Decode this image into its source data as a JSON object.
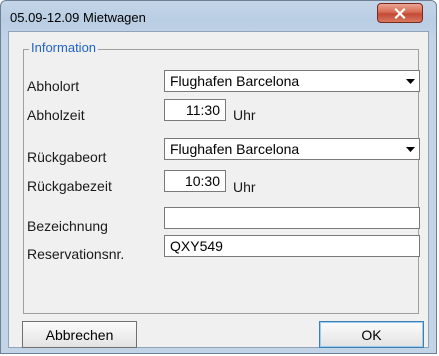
{
  "window": {
    "title": "05.09-12.09 Mietwagen",
    "close_icon": "close-icon"
  },
  "group": {
    "legend": "Information"
  },
  "pickup_location": {
    "label": "Abholort",
    "value": "Flughafen Barcelona",
    "dropdown_icon": "chevron-down-icon"
  },
  "pickup_time": {
    "label": "Abholzeit",
    "value": "11:30",
    "unit": "Uhr"
  },
  "return_location": {
    "label": "Rückgabeort",
    "value": "Flughafen Barcelona",
    "dropdown_icon": "chevron-down-icon"
  },
  "return_time": {
    "label": "Rückgabezeit",
    "value": "10:30",
    "unit": "Uhr"
  },
  "description": {
    "label": "Bezeichnung",
    "value": ""
  },
  "reservation": {
    "label": "Reservationsnr.",
    "value": "QXY549"
  },
  "buttons": {
    "cancel": "Abbrechen",
    "ok": "OK"
  }
}
